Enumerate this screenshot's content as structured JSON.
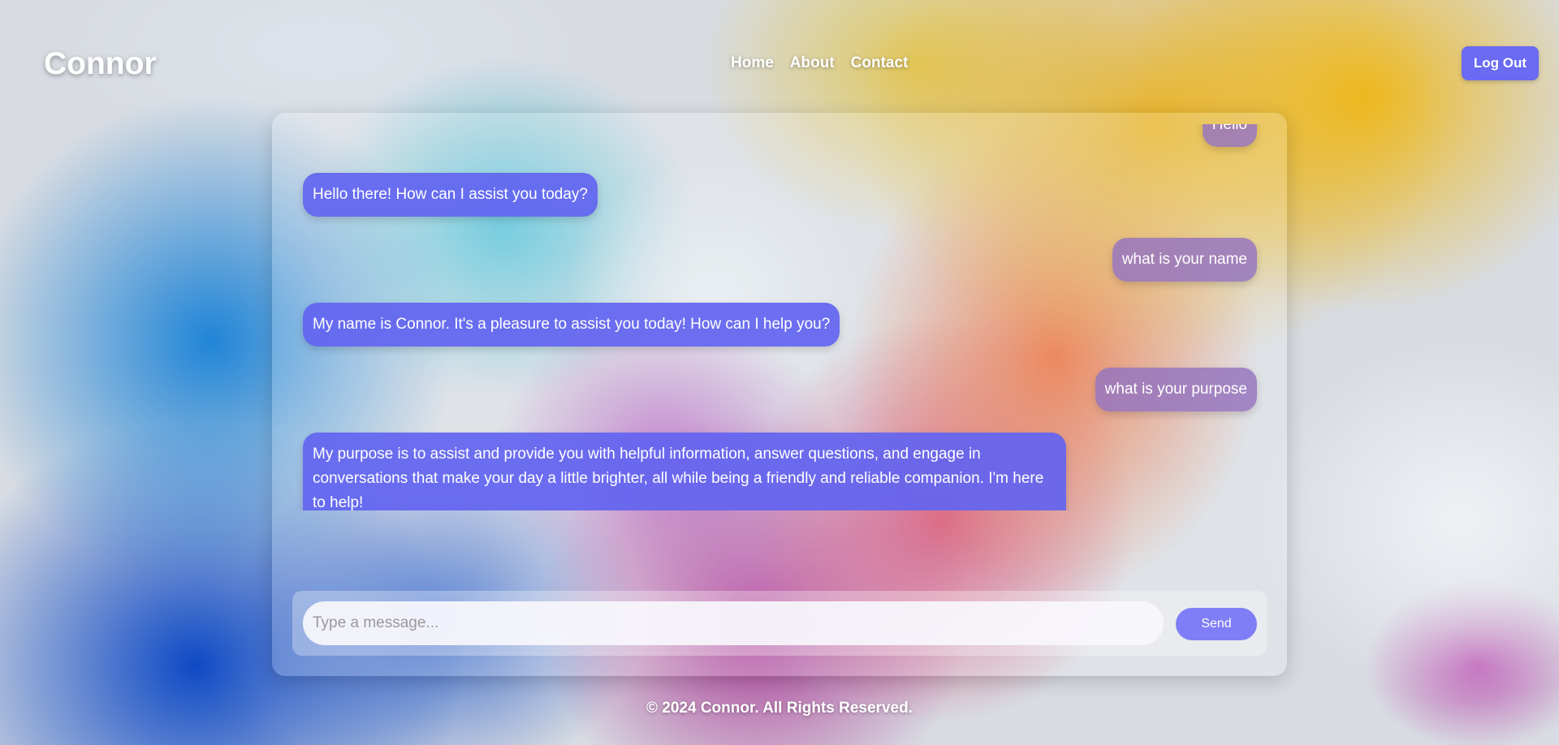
{
  "header": {
    "brand": "Connor",
    "nav": [
      "Home",
      "About",
      "Contact"
    ],
    "logout_label": "Log Out"
  },
  "chat": {
    "messages": [
      {
        "role": "user",
        "text": "Hello"
      },
      {
        "role": "bot",
        "text": "Hello there! How can I assist you today?"
      },
      {
        "role": "user",
        "text": "what is your name"
      },
      {
        "role": "bot",
        "text": "My name is Connor. It's a pleasure to assist you today! How can I help you?"
      },
      {
        "role": "user",
        "text": "what is your purpose"
      },
      {
        "role": "bot",
        "text": "My purpose is to assist and provide you with helpful information, answer questions, and engage in conversations that make your day a little brighter, all while being a friendly and reliable companion. I'm here to help!"
      }
    ],
    "input": {
      "value": "",
      "placeholder": "Type a message..."
    },
    "send_label": "Send"
  },
  "footer": {
    "text": "© 2024 Connor. All Rights Reserved."
  },
  "colors": {
    "accent": "#6a6af2",
    "bot_bubble": "#6264f0",
    "user_bubble": "#9676be",
    "send_button": "#7f7ef6"
  }
}
